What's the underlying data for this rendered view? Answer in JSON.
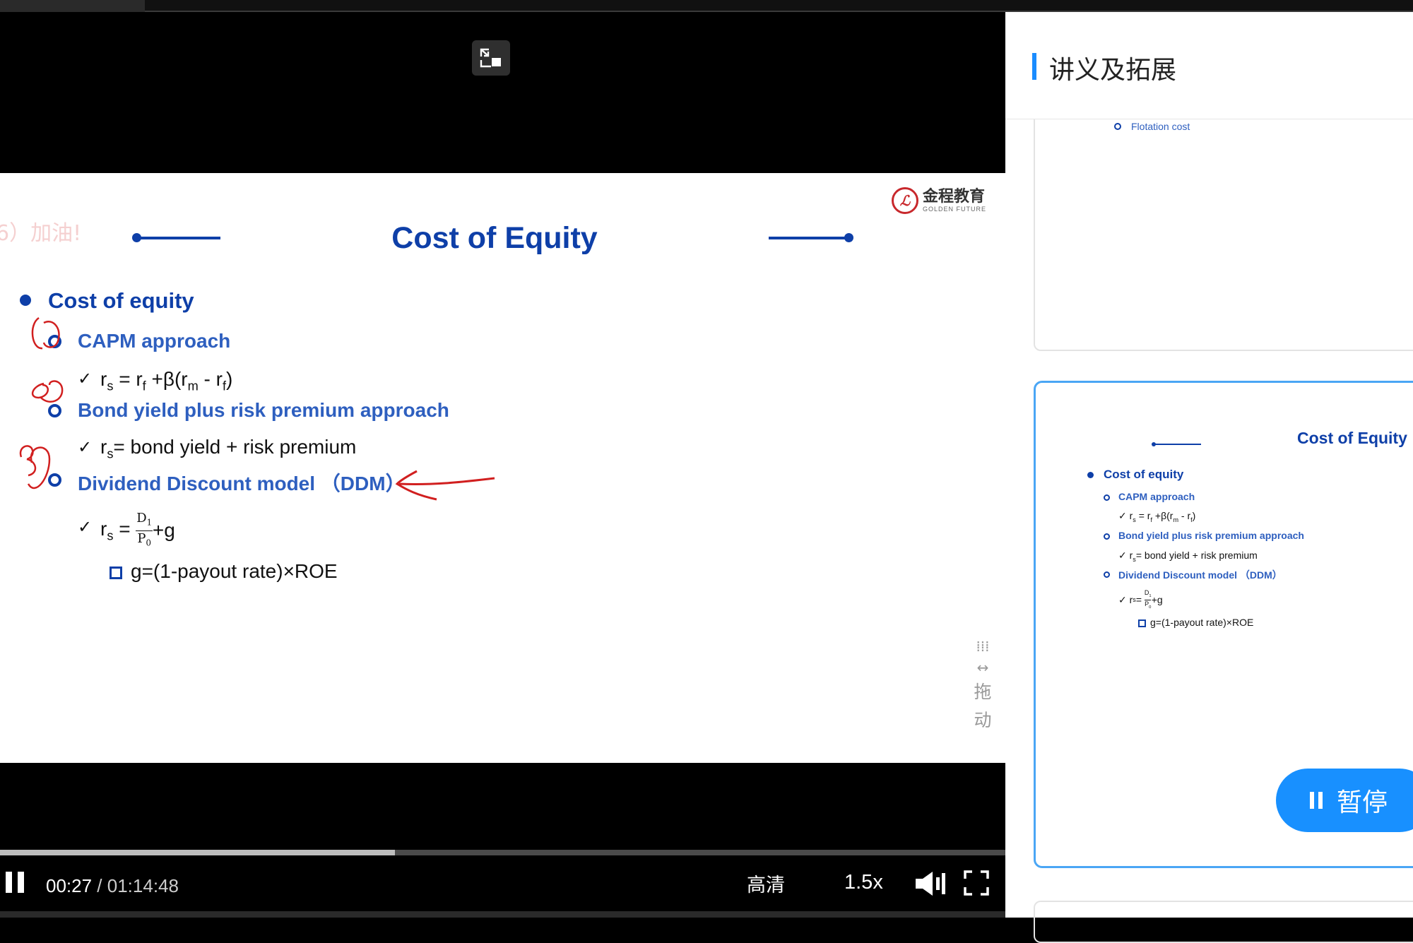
{
  "player": {
    "time_current": "00:27",
    "time_separator": " / ",
    "time_total": "01:14:48",
    "progress_fraction": 0.393,
    "quality_label": "高清",
    "speed_label": "1.5x",
    "drag_label_1": "拖",
    "drag_label_2": "动"
  },
  "slide": {
    "watermark": "6）加油!",
    "logo_cn": "金程教育",
    "logo_en": "GOLDEN FUTURE",
    "title": "Cost of Equity",
    "bullet_main": "Cost of equity",
    "sub1": "CAPM approach",
    "sub2": "Bond yield plus risk premium approach",
    "sub3": "Dividend Discount model （DDM）",
    "formula_bond": "= bond yield + risk premium",
    "formula_growth": "g=(1-payout rate)×ROE"
  },
  "panel": {
    "header_title": "讲义及拓展",
    "prev_card_cut_text": "Flotation cost",
    "pause_label": "暂停"
  },
  "colors": {
    "accent_blue": "#0e3fa8",
    "sub_blue": "#2e5fbf",
    "panel_accent": "#1890ff",
    "annotation_red": "#d11f1f"
  }
}
